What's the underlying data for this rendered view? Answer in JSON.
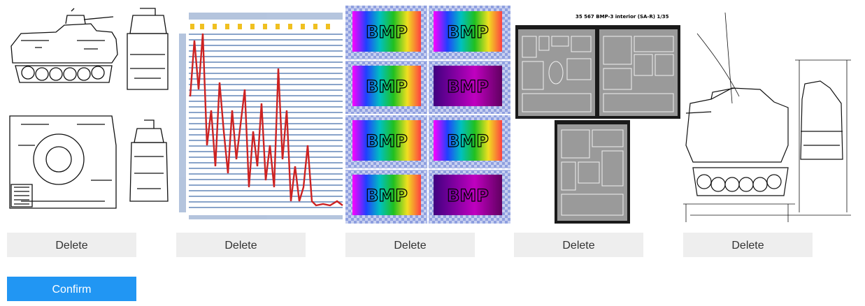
{
  "images": [
    {
      "alt": "BMP-3 line drawing four views",
      "delete_label": "Delete"
    },
    {
      "alt": "Character grid chart with red line",
      "delete_label": "Delete"
    },
    {
      "alt": "BMP color test pattern grid",
      "delete_label": "Delete"
    },
    {
      "alt": "35 567 BMP-3 interior (SA-R) 1/35 photo-etch sheet",
      "delete_label": "Delete"
    },
    {
      "alt": "BMP-3 dimensioned technical drawing",
      "delete_label": "Delete"
    }
  ],
  "bmp_tiles": [
    "BMP",
    "BMP",
    "BMP",
    "BMP",
    "BMP",
    "BMP",
    "BMP",
    "BMP"
  ],
  "etch_sheet_title": "35 567  BMP-3 interior (SA-R) 1/35",
  "confirm_label": "Confirm",
  "colors": {
    "confirm_bg": "#2196f3",
    "delete_bg": "#eeeeee",
    "chart_line": "#cc2222",
    "chart_header": "#f0c020",
    "chart_text": "#2a5aa0"
  }
}
